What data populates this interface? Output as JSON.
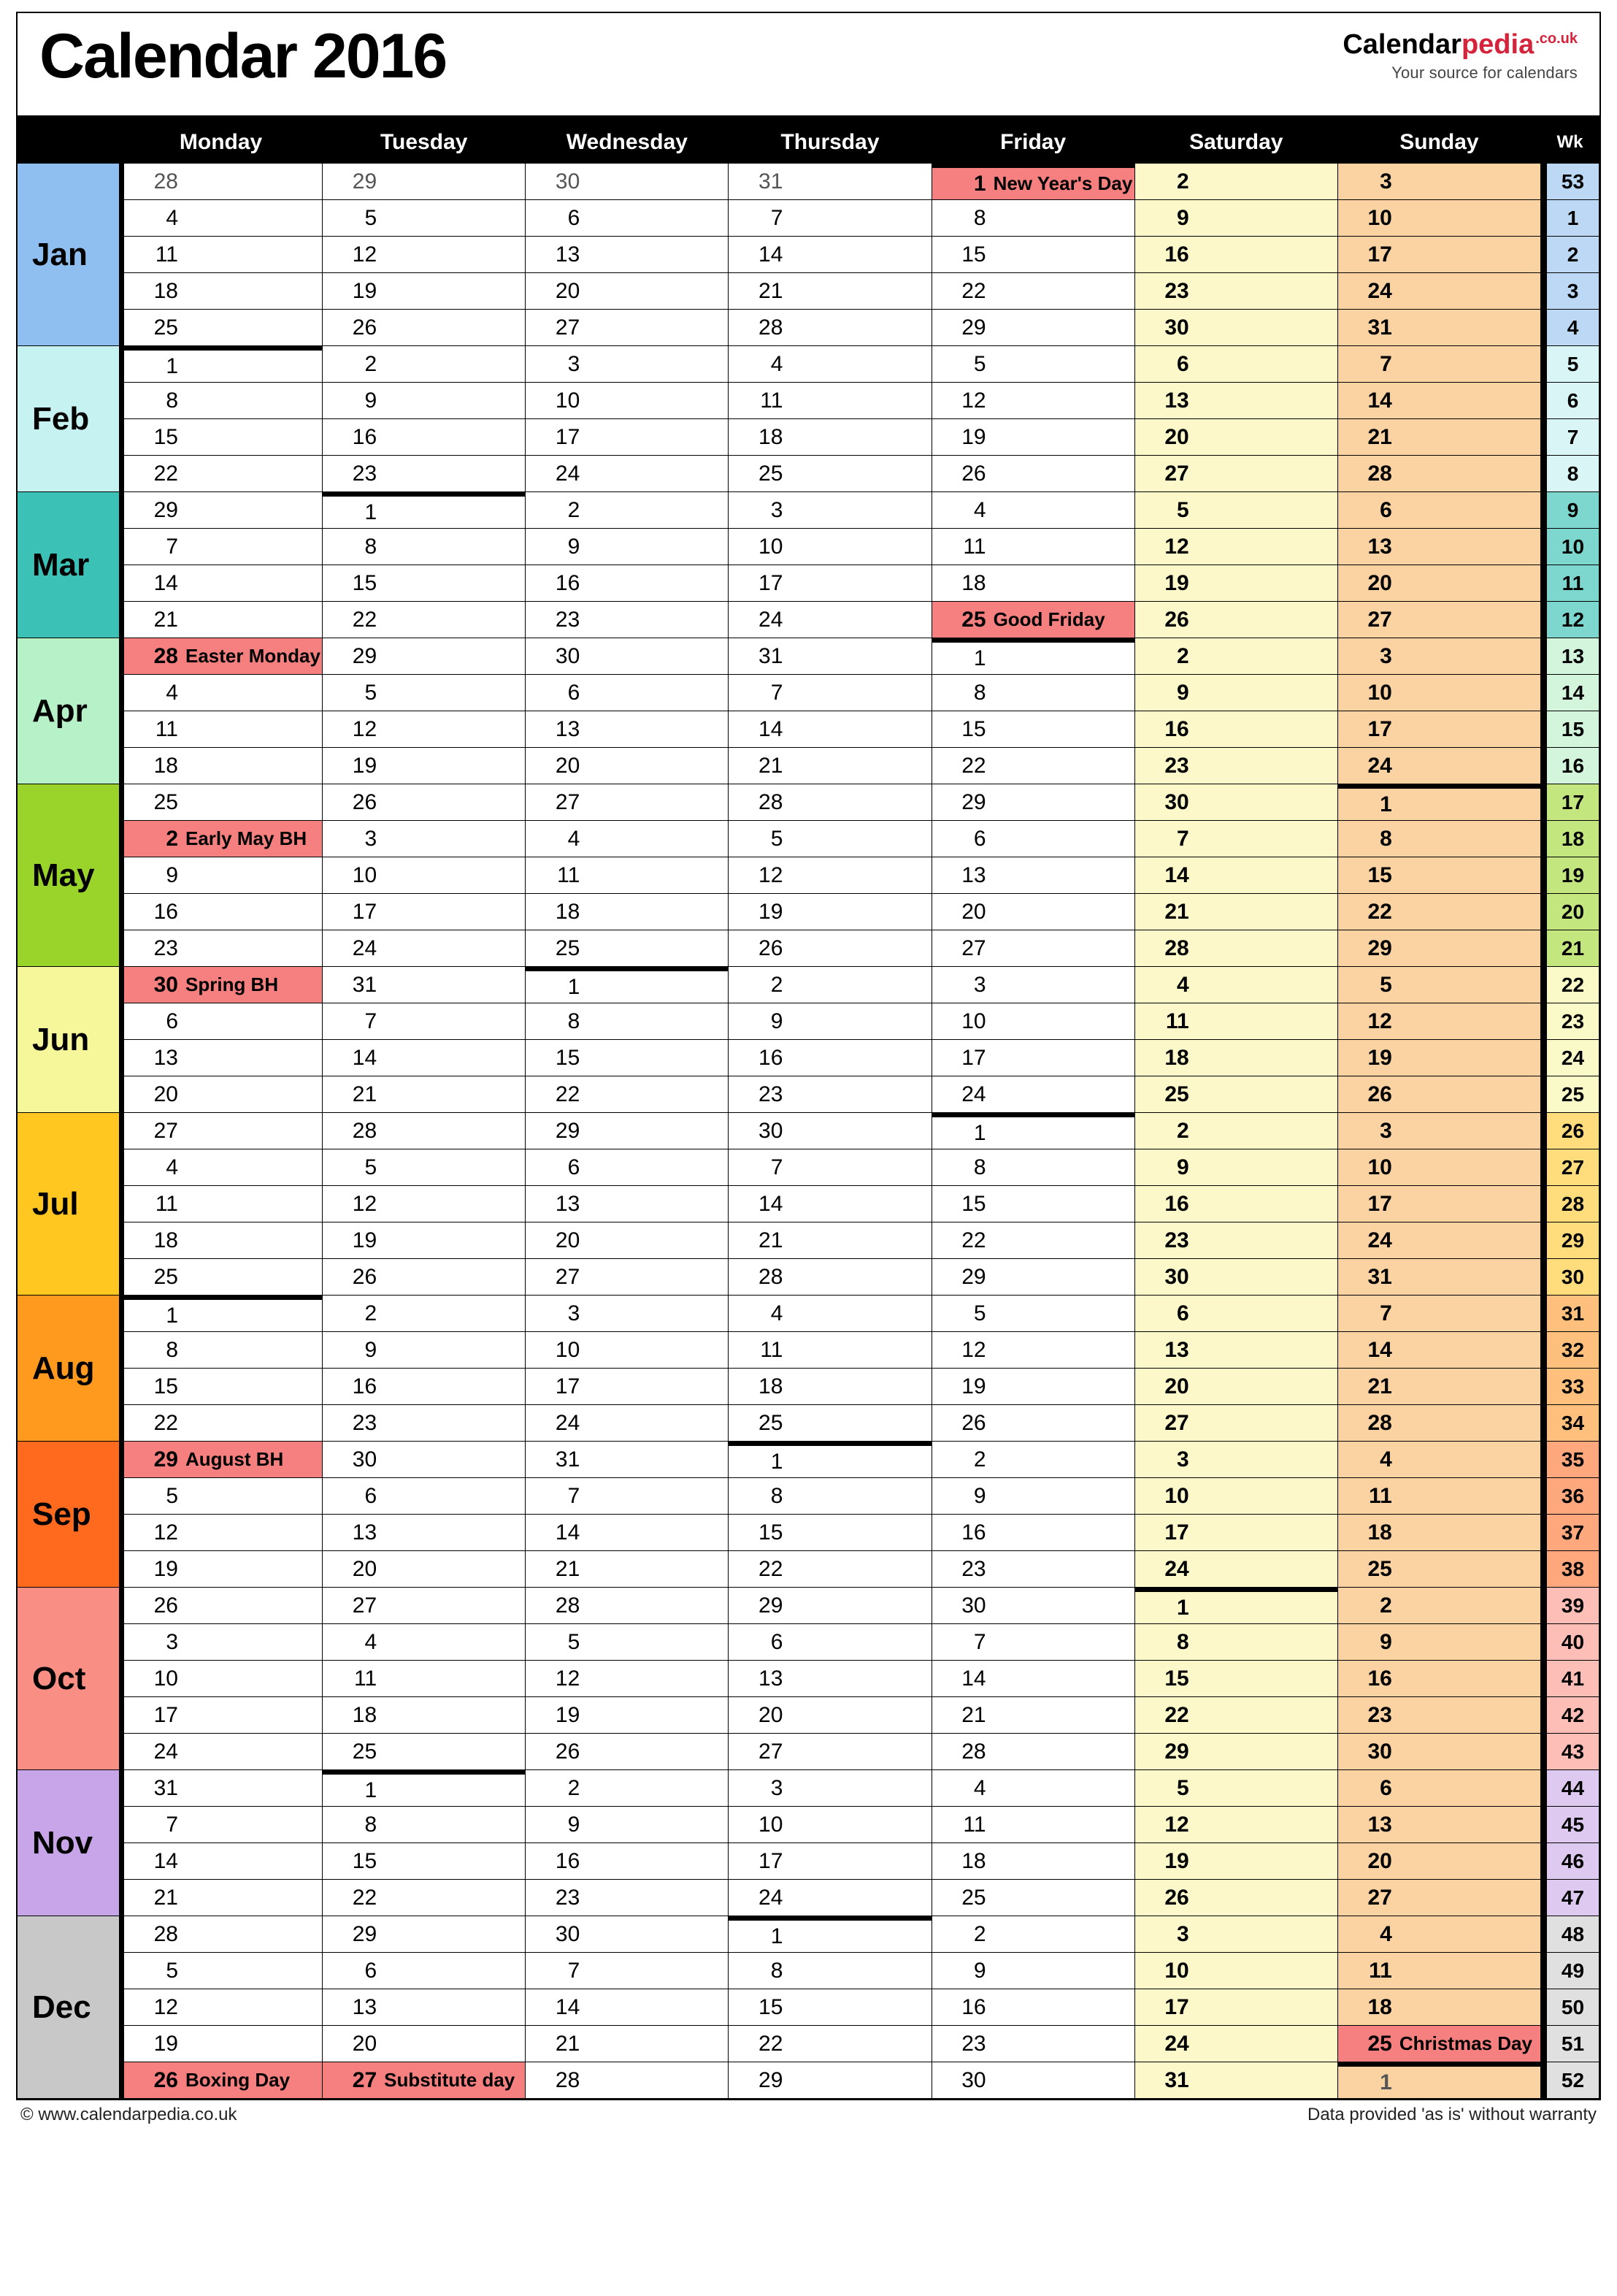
{
  "title": "Calendar 2016",
  "brand": {
    "a": "Calendar",
    "b": "pedia",
    "c": ".co.uk",
    "tag": "Your source for calendars"
  },
  "daynames": [
    "Monday",
    "Tuesday",
    "Wednesday",
    "Thursday",
    "Friday",
    "Saturday",
    "Sunday"
  ],
  "wkhdr": "Wk",
  "footer": {
    "left": "© www.calendarpedia.co.uk",
    "right": "Data provided 'as is' without warranty"
  },
  "months": [
    {
      "id": "jan",
      "label": "Jan",
      "start": 0,
      "len": 31,
      "pm": 31
    },
    {
      "id": "feb",
      "label": "Feb",
      "start": 0,
      "len": 29,
      "pm": 31
    },
    {
      "id": "mar",
      "label": "Mar",
      "start": 1,
      "len": 31,
      "pm": 29
    },
    {
      "id": "apr",
      "label": "Apr",
      "start": 4,
      "len": 30,
      "pm": 31
    },
    {
      "id": "may",
      "label": "May",
      "start": 6,
      "len": 31,
      "pm": 30
    },
    {
      "id": "jun",
      "label": "Jun",
      "start": 2,
      "len": 30,
      "pm": 31
    },
    {
      "id": "jul",
      "label": "Jul",
      "start": 4,
      "len": 31,
      "pm": 30
    },
    {
      "id": "aug",
      "label": "Aug",
      "start": 0,
      "len": 31,
      "pm": 31
    },
    {
      "id": "sep",
      "label": "Sep",
      "start": 3,
      "len": 30,
      "pm": 31
    },
    {
      "id": "oct",
      "label": "Oct",
      "start": 5,
      "len": 31,
      "pm": 30
    },
    {
      "id": "nov",
      "label": "Nov",
      "start": 1,
      "len": 30,
      "pm": 31
    },
    {
      "id": "dec",
      "label": "Dec",
      "start": 3,
      "len": 31,
      "pm": 30
    }
  ],
  "weeks": [
    53,
    1,
    2,
    3,
    4,
    5,
    6,
    7,
    8,
    9,
    10,
    11,
    12,
    13,
    14,
    15,
    16,
    17,
    18,
    19,
    20,
    21,
    22,
    23,
    24,
    25,
    26,
    27,
    28,
    29,
    30,
    31,
    32,
    33,
    34,
    35,
    36,
    37,
    38,
    39,
    40,
    41,
    42,
    43,
    44,
    45,
    46,
    47,
    48,
    49,
    50,
    51,
    52
  ],
  "weekMonth": [
    "jan",
    "jan",
    "jan",
    "jan",
    "jan",
    "feb",
    "feb",
    "feb",
    "feb",
    "mar",
    "mar",
    "mar",
    "mar",
    "apr",
    "apr",
    "apr",
    "apr",
    "may",
    "may",
    "may",
    "may",
    "may",
    "jun",
    "jun",
    "jun",
    "jun",
    "jul",
    "jul",
    "jul",
    "jul",
    "jul",
    "aug",
    "aug",
    "aug",
    "aug",
    "sep",
    "sep",
    "sep",
    "sep",
    "oct",
    "oct",
    "oct",
    "oct",
    "oct",
    "nov",
    "nov",
    "nov",
    "nov",
    "dec",
    "dec",
    "dec",
    "dec",
    "dec"
  ],
  "holidays": {
    "jan-1": "New Year's Day",
    "mar-25": "Good Friday",
    "mar-28": "Easter Monday",
    "may-2": "Early May BH",
    "may-30": "Spring BH",
    "aug-29": "August BH",
    "dec-25": "Christmas Day",
    "dec-26": "Boxing Day",
    "dec-27": "Substitute day"
  }
}
